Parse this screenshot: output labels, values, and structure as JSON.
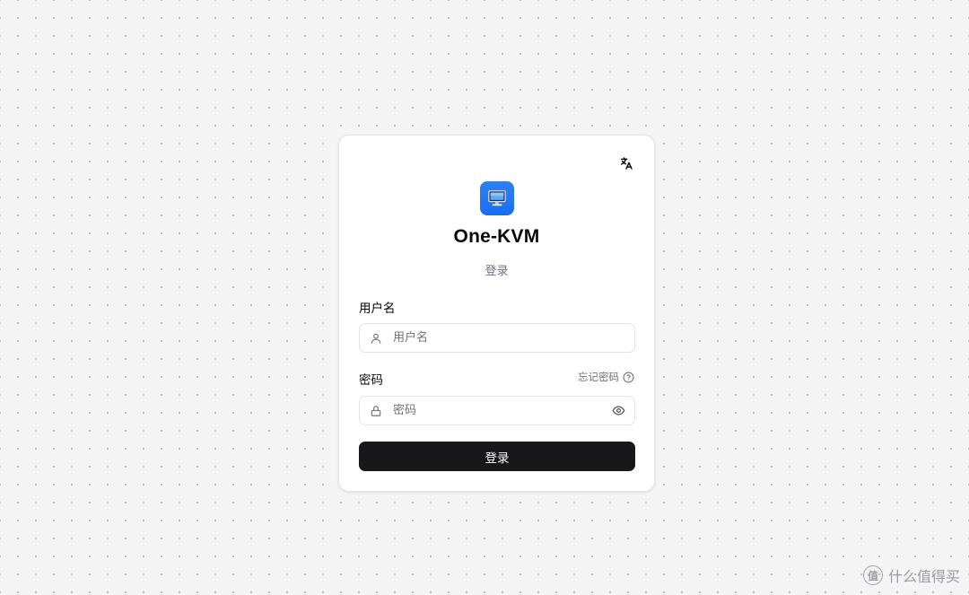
{
  "app": {
    "title": "One-KVM",
    "subtitle": "登录"
  },
  "form": {
    "username_label": "用户名",
    "username_placeholder": "用户名",
    "username_value": "",
    "password_label": "密码",
    "password_placeholder": "密码",
    "password_value": "",
    "forgot_label": "忘记密码",
    "submit_label": "登录"
  },
  "icons": {
    "language": "translate-icon",
    "logo": "monitor-icon",
    "user": "user-icon",
    "lock": "lock-icon",
    "eye": "eye-icon",
    "help": "help-circle-icon"
  },
  "colors": {
    "accent": "#1a6ef0",
    "button_bg": "#18181b",
    "muted_text": "#71717a"
  },
  "watermark": {
    "text": "什么值得买",
    "mark": "值"
  }
}
